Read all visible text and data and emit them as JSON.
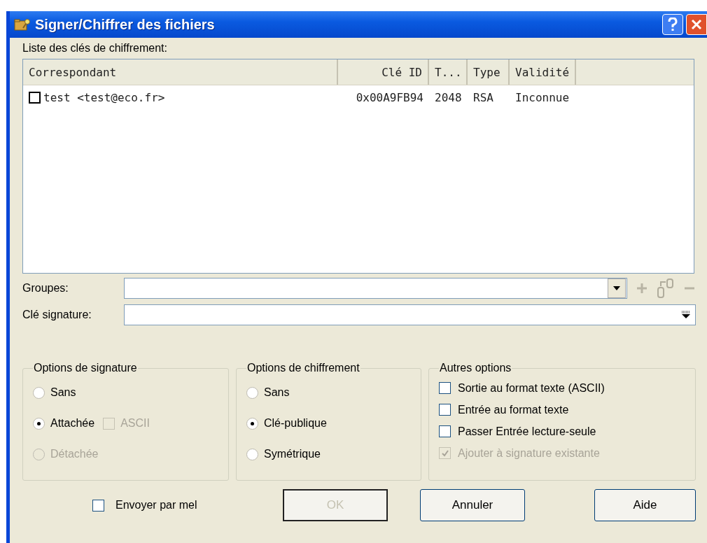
{
  "window": {
    "title": "Signer/Chiffrer des fichiers"
  },
  "key_list": {
    "label": "Liste des clés de chiffrement:",
    "columns": [
      "Correspondant",
      "Clé ID",
      "T...",
      "Type",
      "Validité"
    ],
    "rows": [
      {
        "checked": false,
        "cells": [
          "test <test@eco.fr>",
          "0x00A9FB94",
          "2048",
          "RSA",
          "Inconnue"
        ]
      }
    ]
  },
  "groups": {
    "label": "Groupes:"
  },
  "signature_key": {
    "label": "Clé signature:"
  },
  "signature_options": {
    "title": "Options de signature",
    "items": [
      {
        "label": "Sans",
        "selected": false,
        "disabled": false
      },
      {
        "label": "Attachée",
        "selected": true,
        "disabled": false,
        "ascii": {
          "label": "ASCII",
          "checked": false,
          "disabled": true
        }
      },
      {
        "label": "Détachée",
        "selected": false,
        "disabled": true
      }
    ]
  },
  "encryption_options": {
    "title": "Options de chiffrement",
    "items": [
      {
        "label": "Sans",
        "selected": false,
        "disabled": false
      },
      {
        "label": "Clé-publique",
        "selected": true,
        "disabled": false
      },
      {
        "label": "Symétrique",
        "selected": false,
        "disabled": false
      }
    ]
  },
  "other_options": {
    "title": "Autres options",
    "items": [
      {
        "label": "Sortie au format texte (ASCII)",
        "checked": false,
        "disabled": false
      },
      {
        "label": "Entrée au format texte",
        "checked": false,
        "disabled": false
      },
      {
        "label": "Passer Entrée lecture-seule",
        "checked": false,
        "disabled": false
      },
      {
        "label": "Ajouter à signature existante",
        "checked": true,
        "disabled": true
      }
    ]
  },
  "send_by_mail": {
    "label": "Envoyer par mel",
    "checked": false
  },
  "buttons": [
    {
      "label": "OK",
      "disabled": true
    },
    {
      "label": "Annuler",
      "disabled": false
    },
    {
      "label": "Aide",
      "disabled": false
    }
  ]
}
